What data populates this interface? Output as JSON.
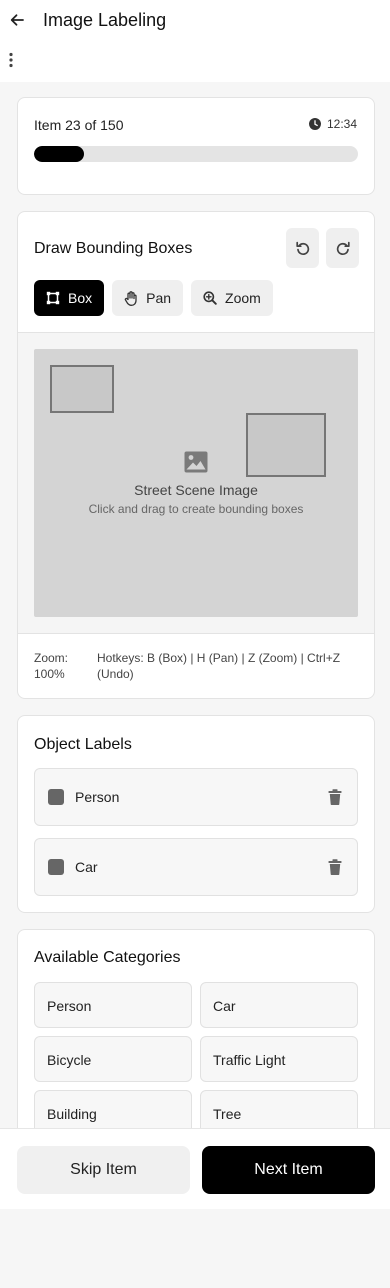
{
  "header": {
    "title": "Image Labeling",
    "back_icon": "arrow-left-icon",
    "menu_icon": "more-vertical-icon"
  },
  "progress": {
    "item_text": "Item 23 of 150",
    "timer": "12:34",
    "fraction": 0.15333
  },
  "draw": {
    "title": "Draw Bounding Boxes",
    "tools": [
      {
        "label": "Box",
        "icon": "box-icon",
        "active": true
      },
      {
        "label": "Pan",
        "icon": "hand-icon",
        "active": false
      },
      {
        "label": "Zoom",
        "icon": "zoom-in-icon",
        "active": false
      }
    ],
    "canvas_label": "Street Scene Image",
    "canvas_hint": "Click and drag to create bounding boxes",
    "zoom_text": "Zoom: 100%",
    "hotkeys": "Hotkeys: B (Box) | H (Pan) | Z (Zoom) | Ctrl+Z (Undo)"
  },
  "labels": {
    "title": "Object Labels",
    "items": [
      {
        "name": "Person",
        "color": "#666666"
      },
      {
        "name": "Car",
        "color": "#666666"
      }
    ]
  },
  "categories": {
    "title": "Available Categories",
    "items": [
      "Person",
      "Car",
      "Bicycle",
      "Traffic Light",
      "Building",
      "Tree"
    ]
  },
  "footer": {
    "skip_label": "Skip Item",
    "next_label": "Next Item"
  },
  "colors": {
    "accent": "#000000",
    "surface": "#ffffff",
    "muted": "#efefef"
  }
}
